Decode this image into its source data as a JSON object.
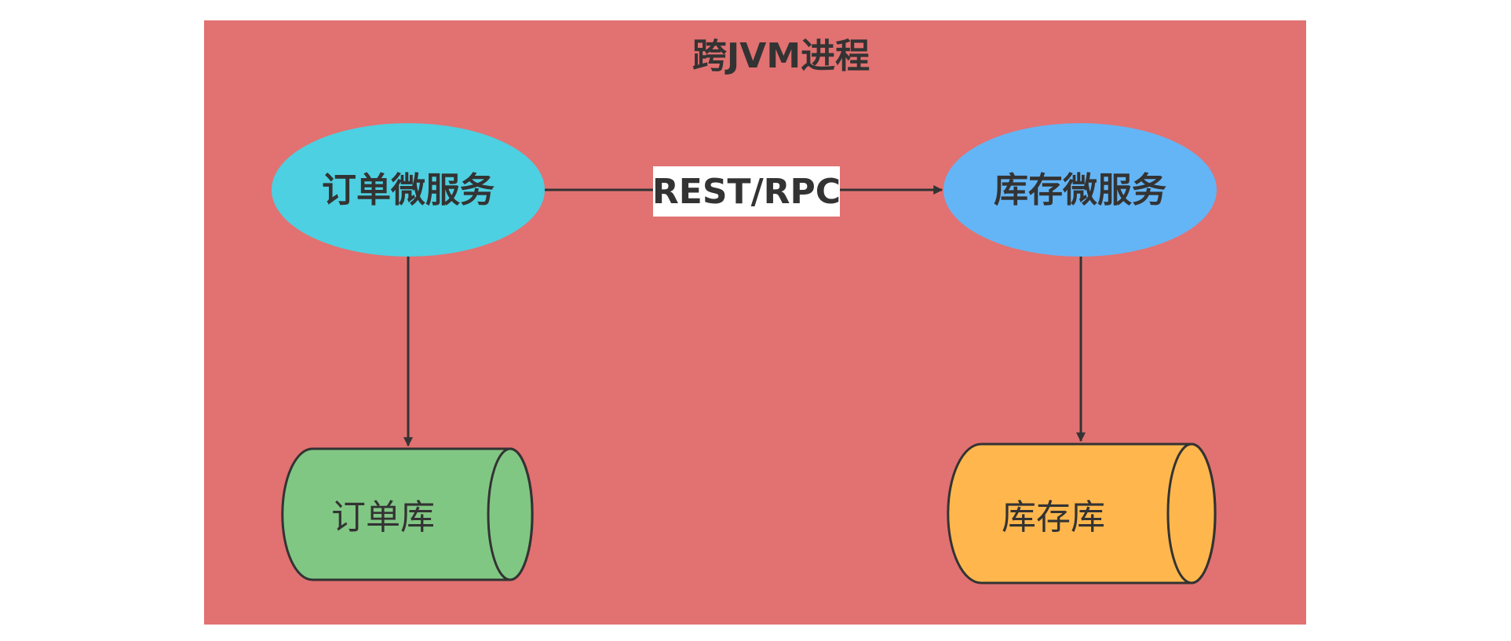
{
  "diagram": {
    "title": "跨JVM进程",
    "nodes": {
      "order_service": "订单微服务",
      "inventory_service": "库存微服务",
      "order_db": "订单库",
      "inventory_db": "库存库"
    },
    "edges": {
      "service_call_label": "REST/RPC"
    },
    "colors": {
      "background": "#e27171",
      "order_service": "#4dd0e1",
      "inventory_service": "#64b5f6",
      "order_db": "#81c784",
      "inventory_db": "#ffb74d",
      "stroke": "#333333",
      "label_bg": "#ffffff"
    }
  }
}
